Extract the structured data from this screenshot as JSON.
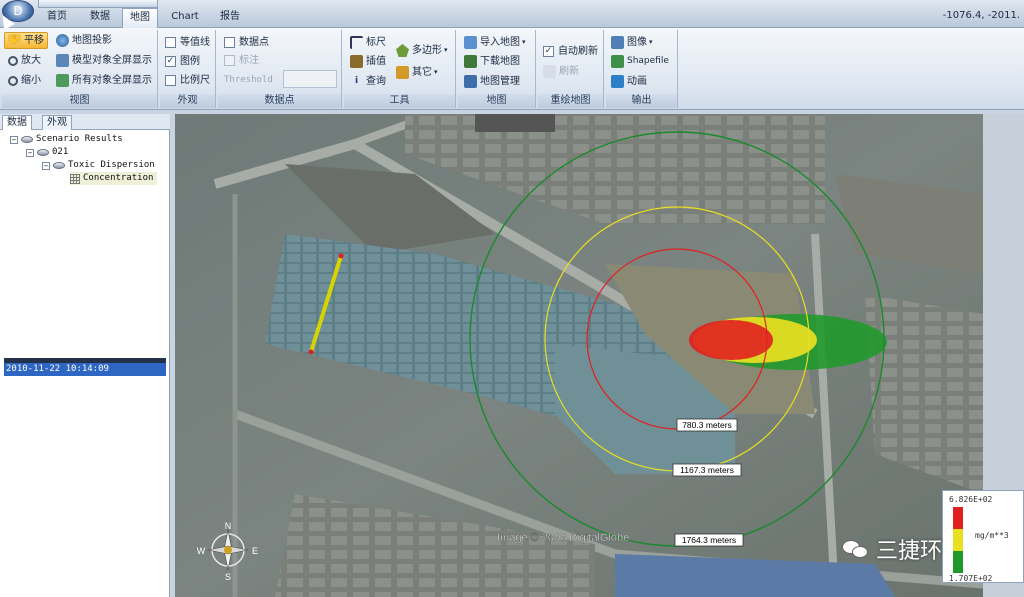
{
  "app": {
    "logo_glyph": "D"
  },
  "tabs": [
    {
      "label": "首页"
    },
    {
      "label": "数据"
    },
    {
      "label": "地图"
    },
    {
      "label": "Chart"
    },
    {
      "label": "报告"
    }
  ],
  "active_tab": "地图",
  "coords_readout": "-1076.4, -2011.",
  "ribbon": {
    "view": {
      "label": "视图",
      "pan": "平移",
      "projection": "地图投影",
      "zoom_in": "放大",
      "model_fullscreen": "模型对象全屏显示",
      "zoom_out": "缩小",
      "all_fullscreen": "所有对象全屏显示"
    },
    "appearance": {
      "label": "外观",
      "contour": "等值线",
      "legend": "图例",
      "scale": "比例尺"
    },
    "datapoints": {
      "label": "数据点",
      "datapoint": "数据点",
      "annotate": "标注",
      "threshold": "Threshold"
    },
    "tools": {
      "label": "工具",
      "ruler": "标尺",
      "polygon": "多边形",
      "interpolate": "插值",
      "other": "其它",
      "query": "查询"
    },
    "map": {
      "label": "地图",
      "import_map": "导入地图",
      "download_map": "下载地图",
      "map_manage": "地图管理"
    },
    "redraw": {
      "label": "重绘地图",
      "auto_refresh": "自动刷新",
      "refresh": "刷新"
    },
    "output": {
      "label": "输出",
      "image": "图像",
      "shapefile": "Shapefile",
      "animation": "动画"
    }
  },
  "panel": {
    "tabs": [
      "数据",
      "外观"
    ],
    "tree": [
      {
        "label": "Scenario Results"
      },
      {
        "label": "021"
      },
      {
        "label": "Toxic Dispersion"
      },
      {
        "label": "Concentration"
      }
    ],
    "selected_time": "2010-11-22 10:14:09"
  },
  "map": {
    "ring_labels": [
      "780.3 meters",
      "1167.3 meters",
      "1764.3 meters"
    ],
    "imagery_credit": "Image © 2008 DigitalGlobe",
    "compass": {
      "n": "N",
      "s": "S",
      "e": "E",
      "w": "W"
    },
    "ring_colors": {
      "inner": "#e02020",
      "middle": "#e8e020",
      "outer": "#1a8a2a"
    }
  },
  "legend": {
    "max": "6.826E+02",
    "unit": "mg/m**3",
    "min": "1.707E+02",
    "colors": [
      "#e02020",
      "#e8e020",
      "#1f9a2a"
    ]
  },
  "watermark": {
    "text": "三捷环境"
  }
}
